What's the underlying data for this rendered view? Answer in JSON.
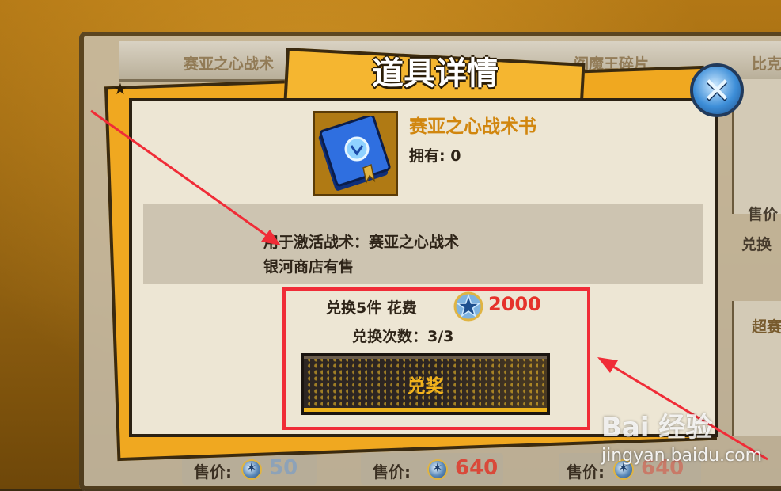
{
  "background_shop": {
    "header_items": [
      "赛亚之心战术",
      "阎魔王碎片",
      "比克"
    ],
    "side_labels": [
      "售价",
      "兑换",
      "超赛"
    ],
    "price_label": "售价:",
    "prices": [
      "50",
      "640",
      "640"
    ]
  },
  "modal": {
    "title": "道具详情",
    "item_name": "赛亚之心战术书",
    "owned": "拥有: 0",
    "description_lines": [
      "用于激活战术：赛亚之心战术",
      "银河商店有售"
    ],
    "cost_label": "兑换5件 花费",
    "cost_value": "2000",
    "exchange_count": "兑换次数：3/3",
    "redeem_button": "兑奖"
  },
  "watermark": {
    "main": "Bai 经验",
    "sub": "jingyan.baidu.com"
  },
  "colors": {
    "highlight_box": "#f02c37",
    "accent_orange": "#f0a820",
    "item_name": "#d1860e",
    "cost_value": "#e5322a",
    "button_text": "#f2b21c"
  },
  "icons": {
    "close": "close-x-icon",
    "currency": "star-coin-icon",
    "item": "blue-book-icon"
  }
}
